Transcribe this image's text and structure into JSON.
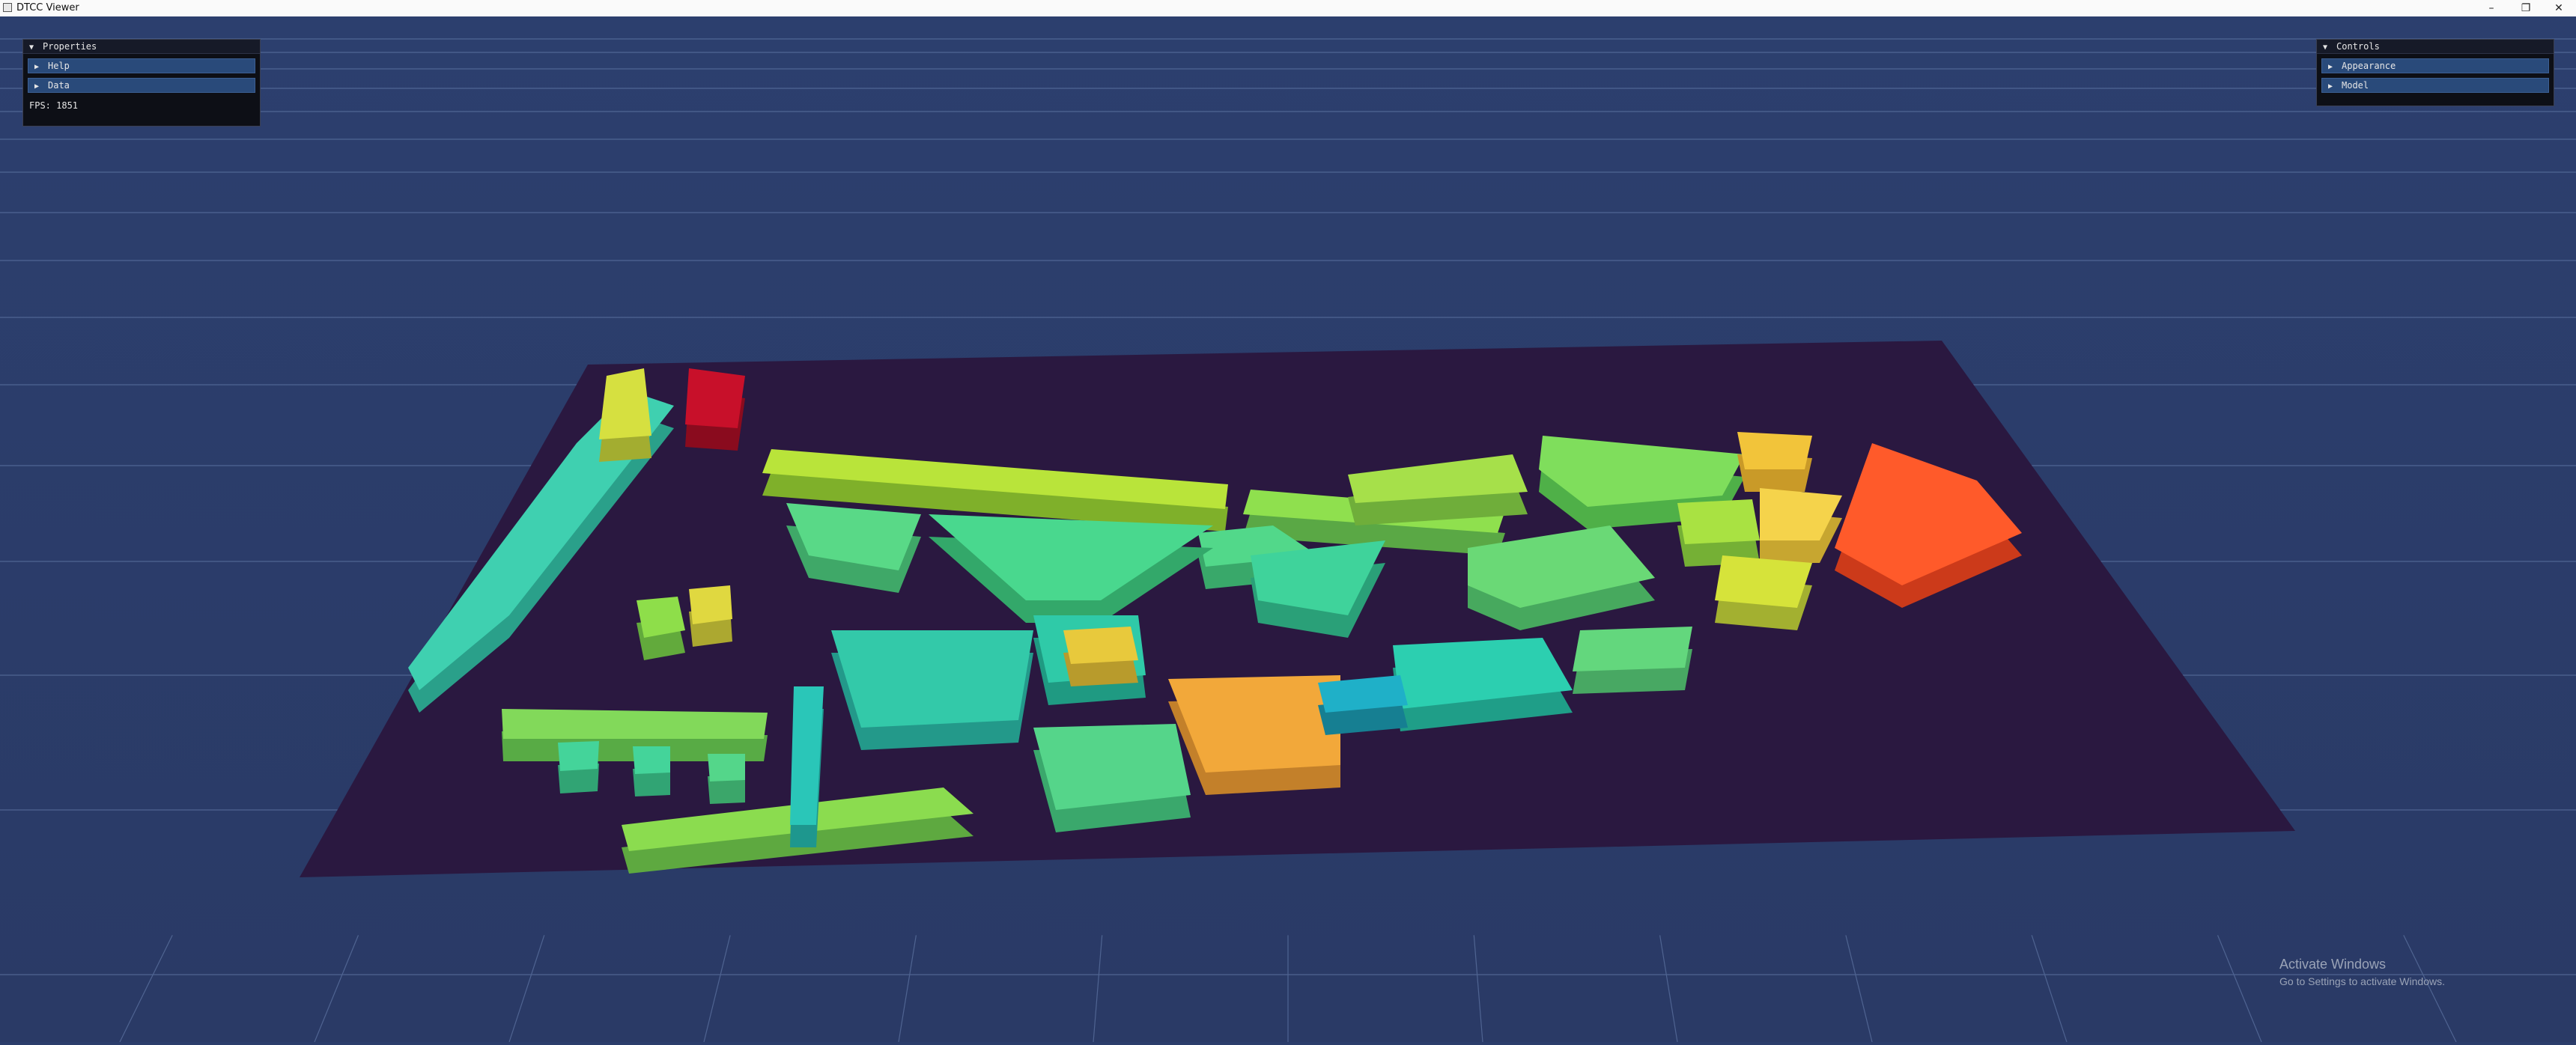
{
  "window": {
    "title": "DTCC Viewer",
    "minimize_glyph": "–",
    "restore_glyph": "❐",
    "close_glyph": "✕"
  },
  "properties_panel": {
    "title": "Properties",
    "items": [
      {
        "label": "Help"
      },
      {
        "label": "Data"
      }
    ],
    "fps": "FPS: 1851"
  },
  "controls_panel": {
    "title": "Controls",
    "items": [
      {
        "label": "Appearance"
      },
      {
        "label": "Model"
      }
    ]
  },
  "watermark": {
    "line1": "Activate Windows",
    "line2": "Go to Settings to activate Windows."
  },
  "colors": {
    "background": "#2b3d6b",
    "ground": "#2a1840",
    "grid": "#6e86b5"
  },
  "icons": {
    "collapse": "▼",
    "expand": "▶"
  }
}
